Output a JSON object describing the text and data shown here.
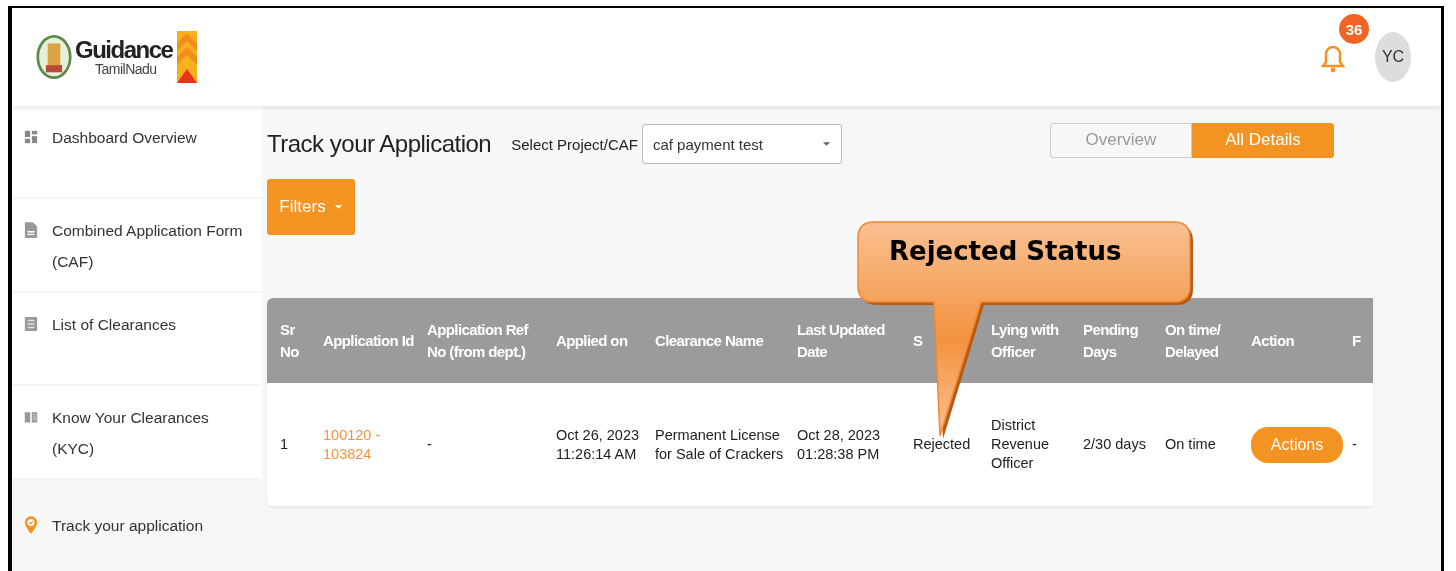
{
  "header": {
    "logo": {
      "title": "Guidance",
      "subtitle": "TamilNadu"
    },
    "notifications": {
      "count": "36"
    },
    "avatar": {
      "initials": "YC"
    }
  },
  "sidebar": {
    "items": [
      {
        "label": "Dashboard Overview",
        "selected": false
      },
      {
        "label": "Combined Application Form (CAF)",
        "selected": false
      },
      {
        "label": "List of Clearances",
        "selected": false
      },
      {
        "label": "Know Your Clearances (KYC)",
        "selected": false
      },
      {
        "label": "Track your application",
        "selected": true
      }
    ]
  },
  "page": {
    "title": "Track your Application",
    "project_label": "Select Project/CAF",
    "project_value": "caf payment test",
    "view_tabs": [
      {
        "label": "Overview",
        "selected": false
      },
      {
        "label": "All Details",
        "selected": true
      }
    ],
    "filters_button": "Filters"
  },
  "table": {
    "columns": [
      "Sr No",
      "Application Id",
      "Application Ref No (from dept.)",
      "Applied on",
      "Clearance Name",
      "Last Updated Date",
      "S",
      "Lying with Officer",
      "Pending Days",
      "On time/ Delayed",
      "Action",
      "F"
    ],
    "rows": [
      {
        "cells": [
          {
            "text": "1",
            "kind": "text"
          },
          {
            "text": "100120 - 103824",
            "kind": "link"
          },
          {
            "text": "-",
            "kind": "text"
          },
          {
            "text": "Oct 26, 2023 11:26:14 AM",
            "kind": "text"
          },
          {
            "text": "Permanent License for Sale of Crackers",
            "kind": "text"
          },
          {
            "text": "Oct 28, 2023 01:28:38 PM",
            "kind": "text"
          },
          {
            "text": "Rejected",
            "kind": "text"
          },
          {
            "text": "District Revenue Officer",
            "kind": "text"
          },
          {
            "text": "2/30 days",
            "kind": "text"
          },
          {
            "text": "On time",
            "kind": "text"
          },
          {
            "text": "Actions",
            "kind": "button"
          },
          {
            "text": "-",
            "kind": "text"
          }
        ]
      }
    ]
  },
  "callout": {
    "text": "Rejected Status"
  }
}
